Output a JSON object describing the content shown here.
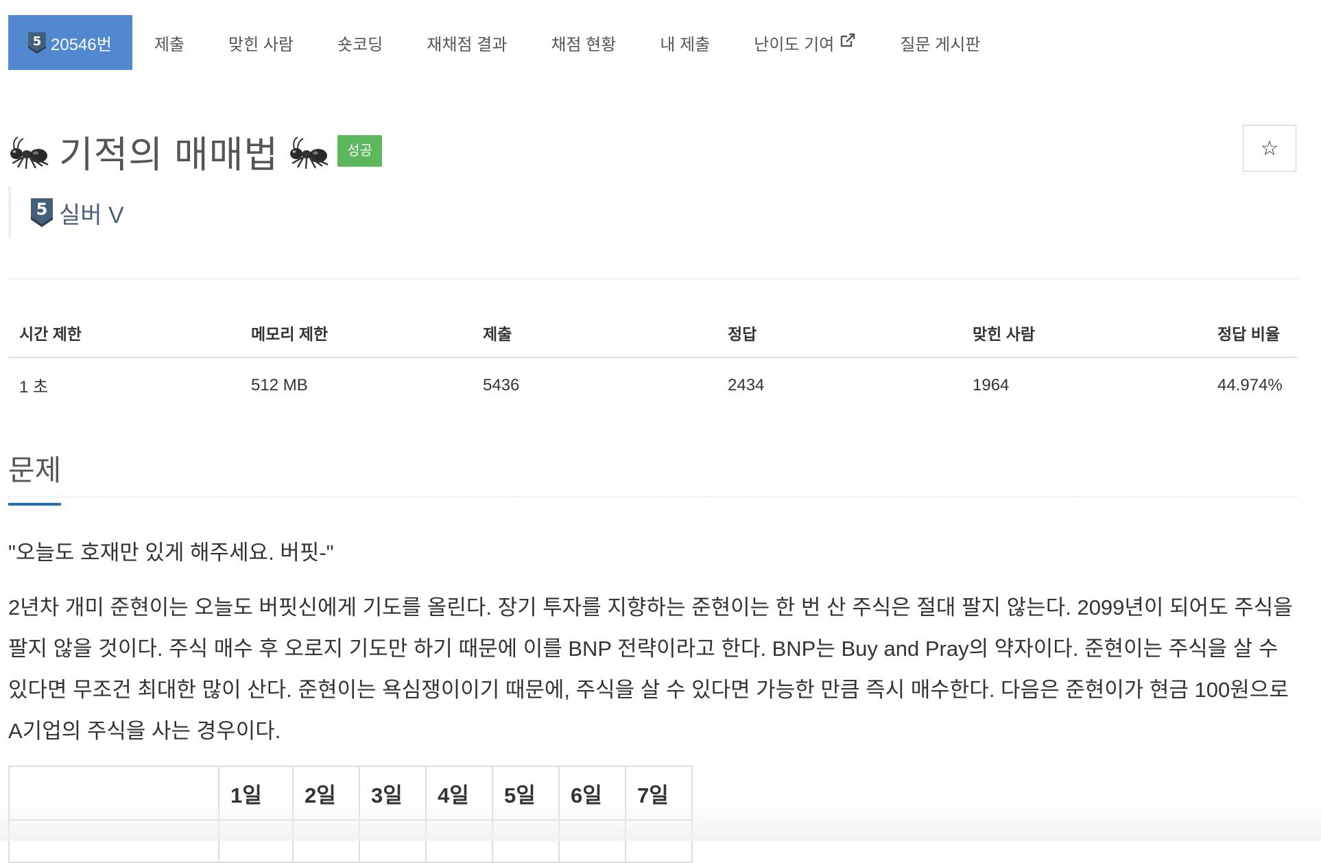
{
  "nav": {
    "problem_id": "20546번",
    "tier_number": "5",
    "items": [
      "제출",
      "맞힌 사람",
      "숏코딩",
      "재채점 결과",
      "채점 현황",
      "내 제출",
      "난이도 기여",
      "질문 게시판"
    ],
    "external_icon": "external-link-icon",
    "active_color": "#5288cf"
  },
  "problem": {
    "title": "기적의 매매법",
    "title_icon": "ant-emoji-icon",
    "status_badge": "성공",
    "status_color": "#5cb85c",
    "star_icon": "☆",
    "tier_number": "5",
    "tier_label": "실버 V",
    "tier_color": "#4a5f7a"
  },
  "info_table": {
    "headers": [
      "시간 제한",
      "메모리 제한",
      "제출",
      "정답",
      "맞힌 사람",
      "정답 비율"
    ],
    "values": [
      "1 초",
      "512 MB",
      "5436",
      "2434",
      "1964",
      "44.974%"
    ]
  },
  "section": {
    "title": "문제",
    "quote": "\"오늘도 호재만 있게 해주세요. 버핏-\"",
    "body": "2년차 개미 준현이는 오늘도 버핏신에게 기도를 올린다. 장기 투자를 지향하는 준현이는 한 번 산 주식은 절대 팔지 않는다. 2099년이 되어도 주식을 팔지 않을 것이다. 주식 매수 후 오로지 기도만 하기 때문에 이를 BNP 전략이라고 한다. BNP는 Buy and Pray의 약자이다. 준현이는 주식을 살 수 있다면 무조건 최대한 많이 산다. 준현이는 욕심쟁이이기 때문에, 주식을 살 수 있다면 가능한 만큼 즉시 매수한다. 다음은 준현이가 현금 100원으로 A기업의 주식을 사는 경우이다."
  },
  "example_table": {
    "headers": [
      "",
      "1일",
      "2일",
      "3일",
      "4일",
      "5일",
      "6일",
      "7일"
    ],
    "first_row_label": "",
    "first_row": [
      "",
      "",
      "",
      "",
      "",
      "",
      "",
      ""
    ]
  }
}
